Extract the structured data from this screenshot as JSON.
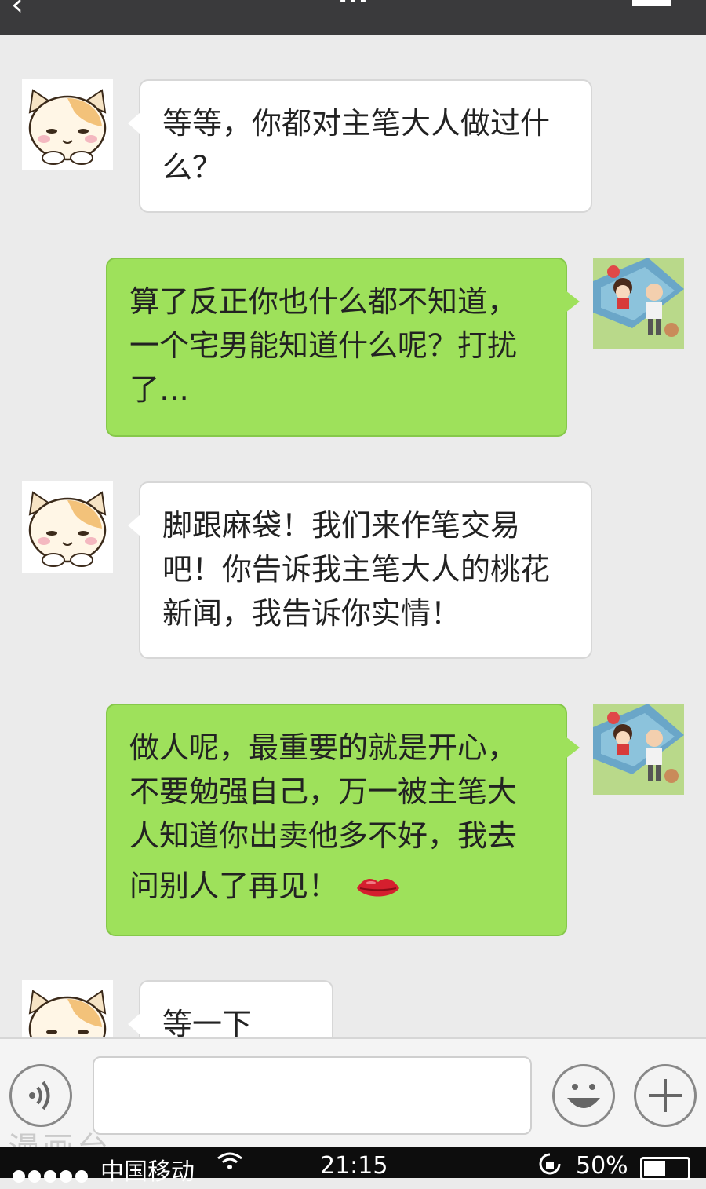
{
  "header": {
    "back_label": "‹",
    "title": "···"
  },
  "messages": [
    {
      "side": "left",
      "avatar": "cat-avatar",
      "lines": [
        "等等，你都对主笔大人做过什",
        "么？"
      ]
    },
    {
      "side": "right",
      "avatar": "picnic-avatar",
      "lines": [
        "算了反正你也什么都不知道，",
        "一个宅男能知道什么呢？打扰",
        "了…"
      ]
    },
    {
      "side": "left",
      "avatar": "cat-avatar",
      "lines": [
        "脚跟麻袋！我们来作笔交易",
        "吧！你告诉我主笔大人的桃花",
        "新闻，我告诉你实情！"
      ]
    },
    {
      "side": "right",
      "avatar": "picnic-avatar",
      "lines": [
        "做人呢，最重要的就是开心，",
        "不要勉强自己，万一被主笔大",
        "人知道你出卖他多不好，我去",
        "问别人了再见！"
      ],
      "emoji": "lips-emoji"
    },
    {
      "side": "left",
      "avatar": "cat-avatar",
      "lines": [
        "等一下啊…"
      ]
    }
  ],
  "input_bar": {
    "voice_icon": "voice-icon",
    "emoji_icon": "smiley-icon",
    "plus_icon": "plus-icon",
    "text_value": ""
  },
  "watermark": "漫画台",
  "status_bar": {
    "carrier": "中国移动",
    "time": "21:15",
    "battery": "50%",
    "battery_level": 0.5
  },
  "colors": {
    "sent_bubble": "#9ee15b",
    "received_bubble": "#ffffff",
    "background": "#ebebeb",
    "status_bar": "#0d0d0d"
  }
}
